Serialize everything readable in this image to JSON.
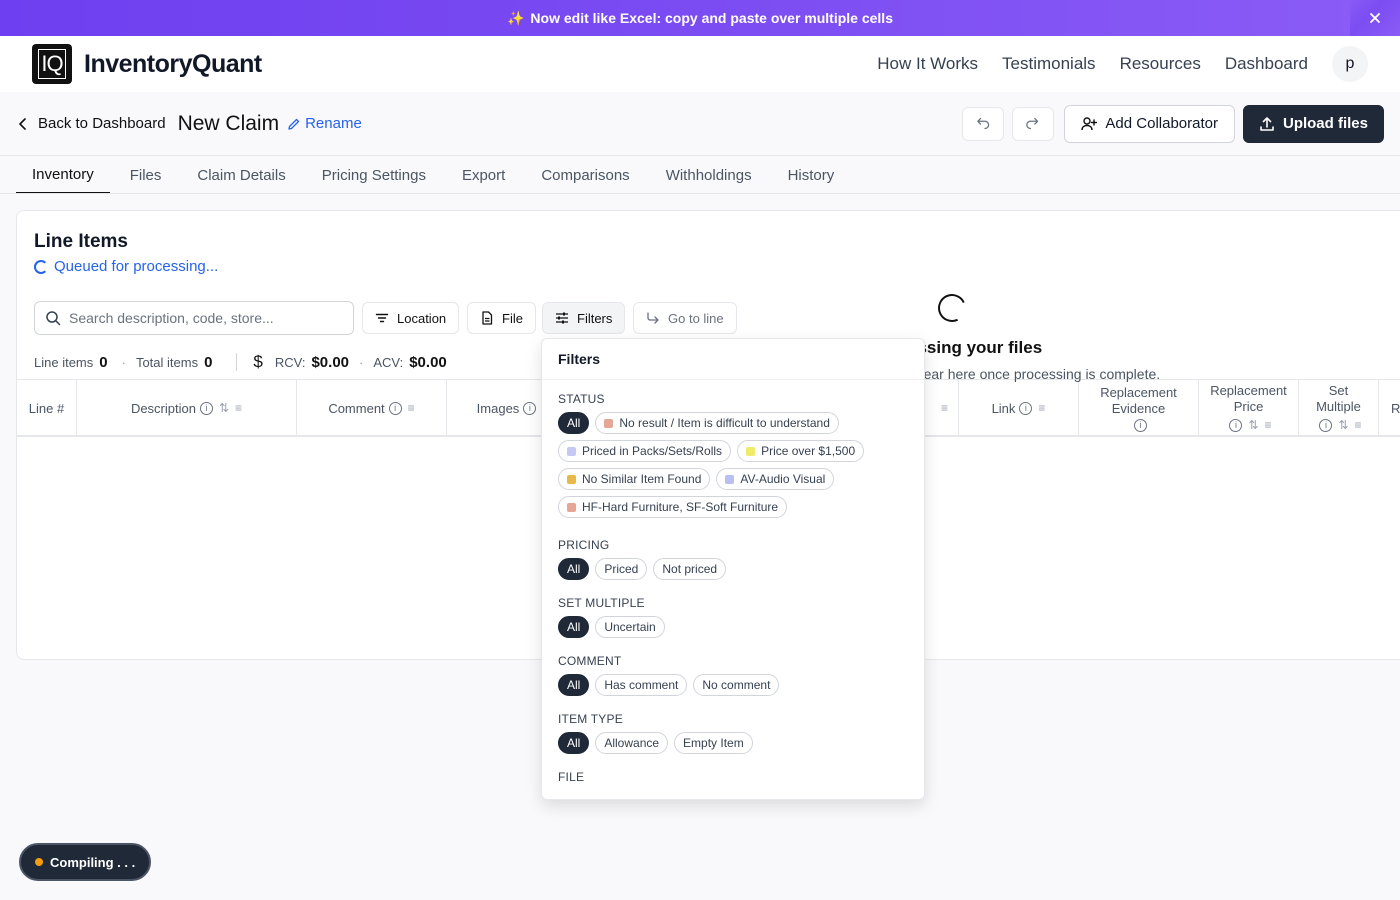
{
  "banner": {
    "icon": "sparkles-icon",
    "text": "Now edit like Excel: copy and paste over multiple cells",
    "close_icon": "close-icon"
  },
  "nav": {
    "logo": "IQ",
    "brand": "InventoryQuant",
    "links": [
      "How It Works",
      "Testimonials",
      "Resources",
      "Dashboard"
    ],
    "avatar": "p"
  },
  "claim": {
    "back_label": "Back to Dashboard",
    "title": "New Claim",
    "rename_label": "Rename",
    "add_collaborator": "Add Collaborator",
    "upload_files": "Upload files"
  },
  "tabs": [
    "Inventory",
    "Files",
    "Claim Details",
    "Pricing Settings",
    "Export",
    "Comparisons",
    "Withholdings",
    "History"
  ],
  "active_tab": "Inventory",
  "line_items": {
    "title": "Line Items",
    "status": "Queued for processing...",
    "search_placeholder": "Search description, code, store...",
    "buttons": {
      "location": "Location",
      "file": "File",
      "filters": "Filters",
      "goto": "Go to line"
    },
    "stats": {
      "line_items_label": "Line items",
      "line_items_value": "0",
      "total_items_label": "Total items",
      "total_items_value": "0",
      "rcv_label": "RCV:",
      "rcv_value": "$0.00",
      "acv_label": "ACV:",
      "acv_value": "$0.00"
    },
    "columns": {
      "line": "Line #",
      "description": "Description",
      "comment": "Comment",
      "images": "Images",
      "link": "Link",
      "replacement_evidence_1": "Replacement",
      "replacement_evidence_2": "Evidence",
      "replacement_price_1": "Replacement",
      "replacement_price_2": "Price",
      "set_multiple_1": "Set",
      "set_multiple_2": "Multiple",
      "next": "R"
    },
    "empty_title": "essing your files",
    "empty_sub": "ppear here once processing is complete."
  },
  "filters": {
    "title": "Filters",
    "status": {
      "label": "STATUS",
      "all": "All",
      "items": [
        {
          "label": "No result / Item is difficult to understand",
          "color": "#e6a595"
        },
        {
          "label": "Priced in Packs/Sets/Rolls",
          "color": "#c7c9f5"
        },
        {
          "label": "Price over $1,500",
          "color": "#f0ec6a"
        },
        {
          "label": "No Similar Item Found",
          "color": "#e8b94a"
        },
        {
          "label": "AV-Audio Visual",
          "color": "#b9bff0"
        },
        {
          "label": "HF-Hard Furniture, SF-Soft Furniture",
          "color": "#e6a595"
        }
      ]
    },
    "pricing": {
      "label": "PRICING",
      "all": "All",
      "items": [
        "Priced",
        "Not priced"
      ]
    },
    "set_multiple": {
      "label": "SET MULTIPLE",
      "all": "All",
      "items": [
        "Uncertain"
      ]
    },
    "comment": {
      "label": "COMMENT",
      "all": "All",
      "items": [
        "Has comment",
        "No comment"
      ]
    },
    "item_type": {
      "label": "ITEM TYPE",
      "all": "All",
      "items": [
        "Allowance",
        "Empty Item"
      ]
    },
    "file": {
      "label": "FILE"
    }
  },
  "toast": {
    "text": "Compiling . . ."
  }
}
